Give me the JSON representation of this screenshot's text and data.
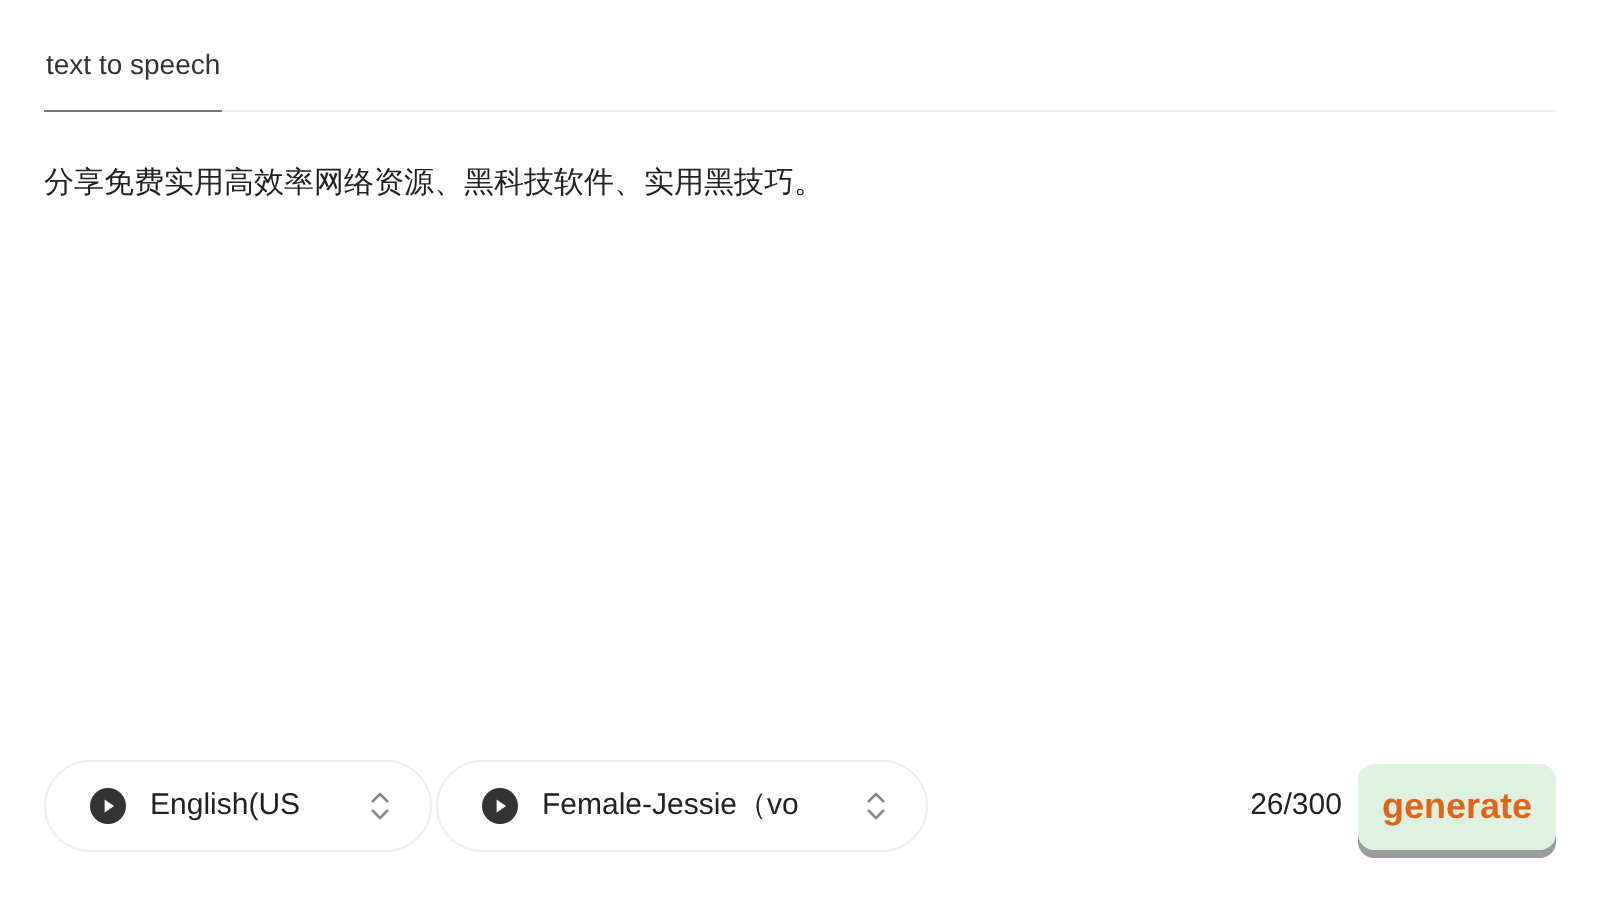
{
  "tabs": [
    {
      "label": "text to speech",
      "selected": true
    }
  ],
  "editor": {
    "value": "分享免费实用高效率网络资源、黑科技软件、实用黑技巧。"
  },
  "selects": [
    {
      "value": "English(US"
    },
    {
      "value": "Female-Jessie（vo"
    }
  ],
  "counter": "26/300",
  "generate_button": "generate"
}
